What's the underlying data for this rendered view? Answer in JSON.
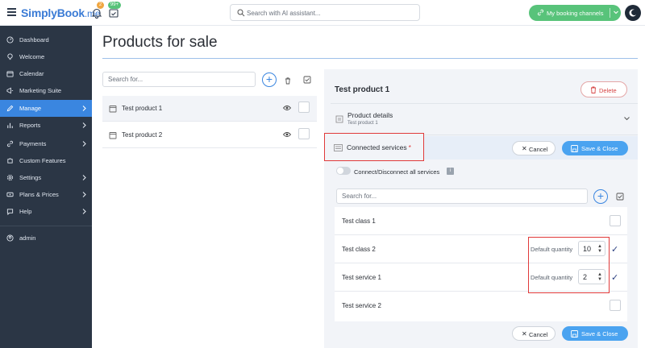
{
  "brand": {
    "name": "SimplyBook",
    "suffix": ".me"
  },
  "notifications": {
    "bell_count": "2",
    "calendar_count": "99+"
  },
  "search": {
    "placeholder": "Search with AI assistant..."
  },
  "header": {
    "channels_label": "My booking channels"
  },
  "colors": {
    "accent": "#3a86e0",
    "sidebar_bg": "#2b3645",
    "success": "#58c37a",
    "danger": "#e03a3a",
    "save": "#4aa3f0"
  },
  "sidebar": {
    "items": [
      {
        "label": "Dashboard",
        "icon": "dashboard-icon",
        "arrow": false
      },
      {
        "label": "Welcome",
        "icon": "lightbulb-icon",
        "arrow": false
      },
      {
        "label": "Calendar",
        "icon": "calendar-icon",
        "arrow": false
      },
      {
        "label": "Marketing Suite",
        "icon": "megaphone-icon",
        "arrow": false
      },
      {
        "label": "Manage",
        "icon": "pencil-icon",
        "arrow": true,
        "active": true
      },
      {
        "label": "Reports",
        "icon": "chart-icon",
        "arrow": true
      },
      {
        "label": "Payments",
        "icon": "link-icon",
        "arrow": true
      },
      {
        "label": "Custom Features",
        "icon": "puzzle-icon",
        "arrow": false
      },
      {
        "label": "Settings",
        "icon": "gear-icon",
        "arrow": true
      },
      {
        "label": "Plans & Prices",
        "icon": "tag-icon",
        "arrow": true
      },
      {
        "label": "Help",
        "icon": "chat-icon",
        "arrow": true
      }
    ],
    "user": "admin"
  },
  "page": {
    "title": "Products for sale"
  },
  "products": {
    "search_placeholder": "Search for...",
    "rows": [
      "Test product 1",
      "Test product 2"
    ]
  },
  "detail": {
    "title": "Test product 1",
    "delete_label": "Delete",
    "product_details_label": "Product details",
    "product_details_sub": "Test product 1",
    "connected_label": "Connected services",
    "connected_required": "*",
    "cancel_label": "Cancel",
    "save_label": "Save & Close",
    "toggle_label": "Connect/Disconnect all services",
    "services_search_placeholder": "Search for...",
    "services": [
      {
        "name": "Test class 1",
        "checked": false
      },
      {
        "name": "Test class 2",
        "checked": true,
        "qty_label": "Default quantity",
        "qty": "10"
      },
      {
        "name": "Test service 1",
        "checked": true,
        "qty_label": "Default quantity",
        "qty": "2"
      },
      {
        "name": "Test service 2",
        "checked": false
      }
    ]
  }
}
